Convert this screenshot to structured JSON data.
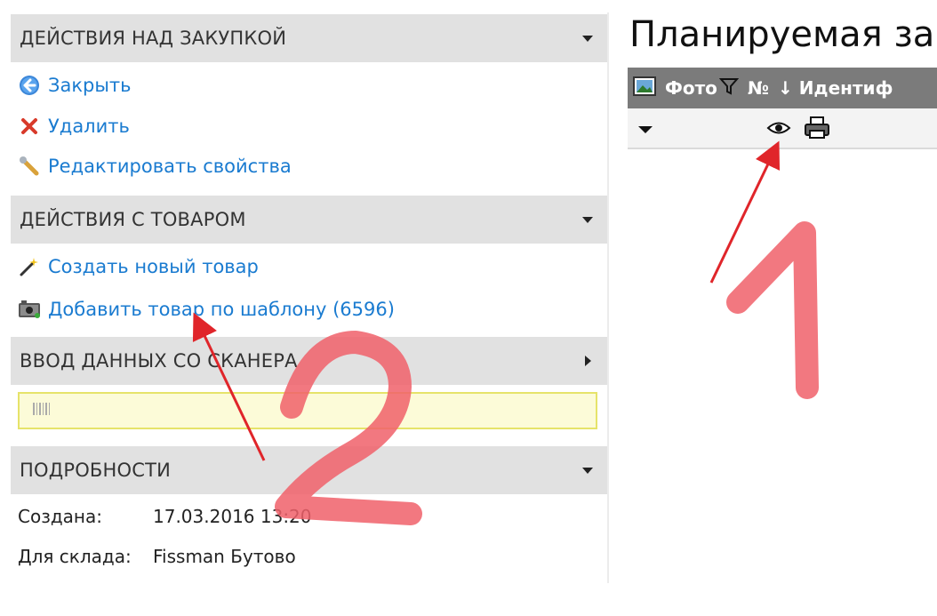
{
  "sidebar": {
    "purchase_actions": {
      "title": "ДЕЙСТВИЯ НАД ЗАКУПКОЙ",
      "items": [
        {
          "label": "Закрыть",
          "icon": "back-arrow-icon"
        },
        {
          "label": "Удалить",
          "icon": "delete-x-icon"
        },
        {
          "label": "Редактировать свойства",
          "icon": "wrench-icon"
        }
      ]
    },
    "product_actions": {
      "title": "ДЕЙСТВИЯ С ТОВАРОМ",
      "items": [
        {
          "label": "Создать новый товар",
          "icon": "magic-wand-icon"
        },
        {
          "label": "Добавить товар по шаблону (6596)",
          "icon": "camera-icon"
        }
      ]
    },
    "scanner": {
      "title": "ВВОД ДАННЫХ СО СКАНЕРА",
      "placeholder_icon": "barcode-icon"
    },
    "details": {
      "title": "ПОДРОБНОСТИ",
      "created_label": "Создана:",
      "created_value": "17.03.2016 13:20",
      "warehouse_label": "Для склада:",
      "warehouse_value": "Fissman Бутово"
    }
  },
  "main": {
    "title": "Планируемая за",
    "columns": [
      "Фото",
      "№",
      "↓ Идентиф"
    ]
  },
  "annotations": {
    "label_1": "1",
    "label_2": "2",
    "color": "#f0606a"
  }
}
